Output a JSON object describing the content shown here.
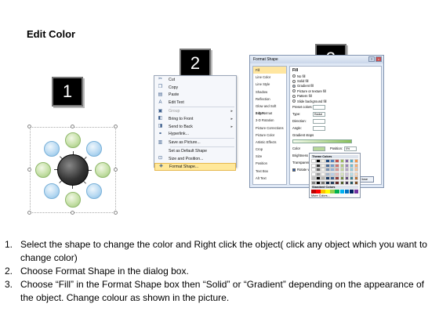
{
  "slide": {
    "title": "Edit Color"
  },
  "badges": [
    "1",
    "2",
    "3"
  ],
  "diagram": {
    "hub_color": "#2b2b2b",
    "orb_colors": [
      "green",
      "blue",
      "green",
      "blue",
      "green",
      "blue",
      "green",
      "blue"
    ]
  },
  "context_menu": {
    "items": [
      {
        "icon": "cut-icon",
        "glyph": "✂",
        "label": "Cut",
        "state": "normal"
      },
      {
        "icon": "copy-icon",
        "glyph": "❐",
        "label": "Copy",
        "state": "normal"
      },
      {
        "icon": "paste-icon",
        "glyph": "▤",
        "label": "Paste",
        "state": "normal"
      },
      {
        "icon": "edit-text-icon",
        "glyph": "A",
        "label": "Edit Text",
        "state": "normal",
        "separator_after": true
      },
      {
        "icon": "group-icon",
        "glyph": "▣",
        "label": "Group",
        "state": "disabled",
        "arrow": true
      },
      {
        "icon": "bring-front-icon",
        "glyph": "◧",
        "label": "Bring to Front",
        "state": "normal",
        "arrow": true
      },
      {
        "icon": "send-back-icon",
        "glyph": "◨",
        "label": "Send to Back",
        "state": "normal",
        "arrow": true
      },
      {
        "icon": "hyperlink-icon",
        "glyph": "⚭",
        "label": "Hyperlink...",
        "state": "normal",
        "separator_after": true
      },
      {
        "icon": "save-picture-icon",
        "glyph": "▥",
        "label": "Save as Picture...",
        "state": "normal",
        "separator_after": true
      },
      {
        "icon": "default-shape-icon",
        "glyph": "",
        "label": "Set as Default Shape",
        "state": "normal"
      },
      {
        "icon": "size-position-icon",
        "glyph": "⊡",
        "label": "Size and Position...",
        "state": "normal"
      },
      {
        "icon": "format-shape-icon",
        "glyph": "◈",
        "label": "Format Shape...",
        "state": "highlighted"
      }
    ]
  },
  "format_dialog": {
    "title": "Format Shape",
    "nav": [
      "Fill",
      "Line Color",
      "Line Style",
      "Shadow",
      "Reflection",
      "Glow and Soft Edges",
      "3-D Format",
      "3-D Rotation",
      "Picture Corrections",
      "Picture Color",
      "Artistic Effects",
      "Crop",
      "Size",
      "Position",
      "Text Box",
      "Alt Text"
    ],
    "fill_heading": "Fill",
    "fill_options": [
      {
        "label": "No fill",
        "checked": false
      },
      {
        "label": "Solid fill",
        "checked": false
      },
      {
        "label": "Gradient fill",
        "checked": true
      },
      {
        "label": "Picture or texture fill",
        "checked": false
      },
      {
        "label": "Pattern fill",
        "checked": false
      },
      {
        "label": "Slide background fill",
        "checked": false
      }
    ],
    "rows": [
      {
        "label": "Preset colors:"
      },
      {
        "label": "Type:",
        "value": "Radial"
      },
      {
        "label": "Direction:"
      },
      {
        "label": "Angle:"
      }
    ],
    "gradient_stops_label": "Gradient stops",
    "color_label": "Color",
    "position_label": "Position:",
    "position_value": "0%",
    "brightness_label": "Brightness",
    "transparency_label": "Transparency",
    "rotate_label": "Rotate with shape",
    "close_label": "Close"
  },
  "palette": {
    "theme_heading": "Theme Colors",
    "standard_heading": "Standard Colors",
    "more_label": "More Colors...",
    "theme_top": [
      "#ffffff",
      "#000000",
      "#eeece1",
      "#1f497d",
      "#4f81bd",
      "#c0504d",
      "#9bbb59",
      "#8064a2",
      "#4bacc6",
      "#f79646"
    ],
    "standard": [
      "#c00000",
      "#ff0000",
      "#ffc000",
      "#ffff00",
      "#92d050",
      "#00b050",
      "#00b0f0",
      "#0070c0",
      "#002060",
      "#7030a0"
    ]
  },
  "instructions": [
    {
      "num": "1.",
      "text": "Select the shape to change the color and Right click the object( click any object which you want to change color)"
    },
    {
      "num": "2.",
      "text": "Choose Format Shape in the dialog box."
    },
    {
      "num": "3.",
      "text": "Choose “Fill” in the Format Shape box then “Solid” or “Gradient” depending on the appearance of the object. Change colour as shown in the picture."
    }
  ]
}
